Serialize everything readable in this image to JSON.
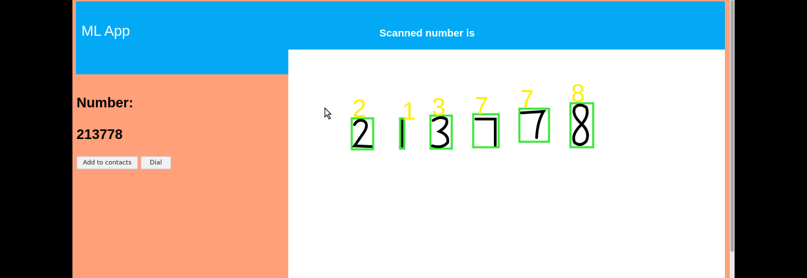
{
  "app": {
    "title": "ML App"
  },
  "canvas": {
    "title": "Scanned number is",
    "predictions": [
      "2",
      "1",
      "3",
      "7",
      "7",
      "8"
    ]
  },
  "sidebar": {
    "number_label": "Number:",
    "number_value": "213778",
    "buttons": {
      "add_contacts": "Add to contacts",
      "dial": "Dial"
    }
  },
  "colors": {
    "header": "#03a9f4",
    "sidebar": "#ffa07a",
    "box": "#39e639",
    "prediction": "#ffee00"
  }
}
